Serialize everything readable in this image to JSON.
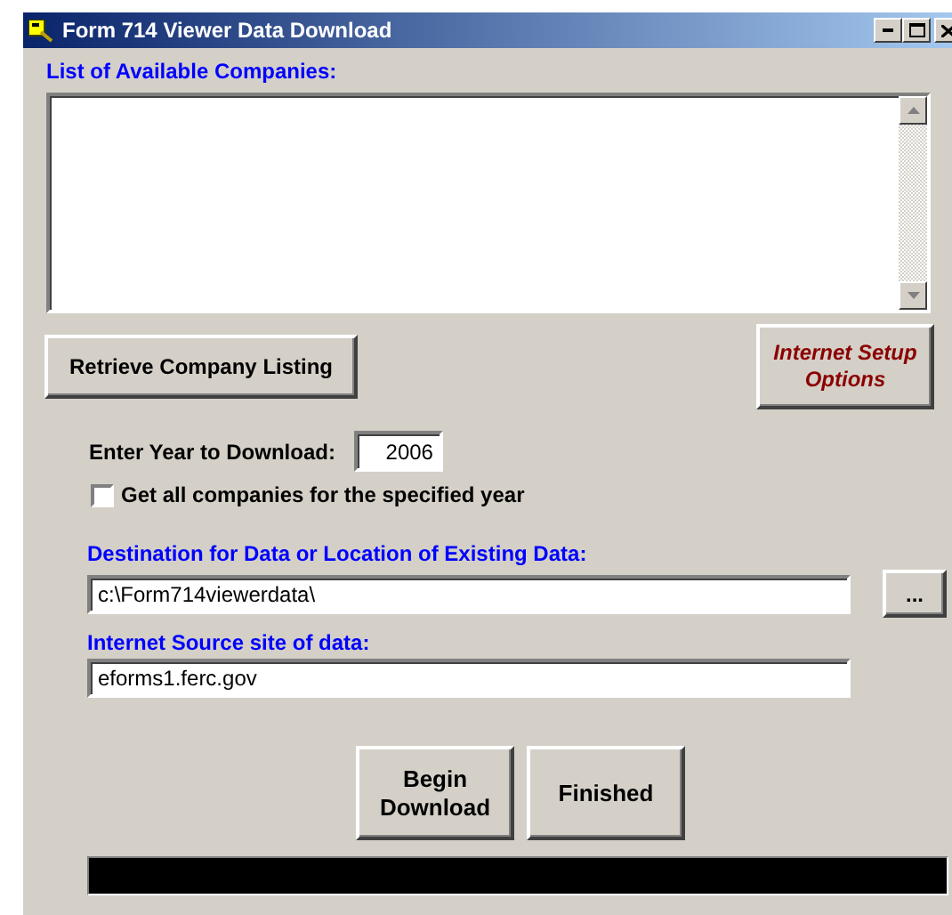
{
  "window": {
    "title": "Form 714 Viewer Data Download"
  },
  "companies": {
    "label": "List of Available Companies:"
  },
  "retrieve_button": "Retrieve Company Listing",
  "setup_button": "Internet Setup Options",
  "year": {
    "label": "Enter Year to Download:",
    "value": "2006"
  },
  "all_companies": {
    "label": "Get all companies for the specified year",
    "checked": false
  },
  "destination": {
    "label": "Destination for Data or Location of Existing Data:",
    "value": "c:\\Form714viewerdata\\"
  },
  "browse_button": "...",
  "source": {
    "label": "Internet Source site of data:",
    "value": "eforms1.ferc.gov"
  },
  "buttons": [
    "Begin Download",
    "Finished"
  ]
}
